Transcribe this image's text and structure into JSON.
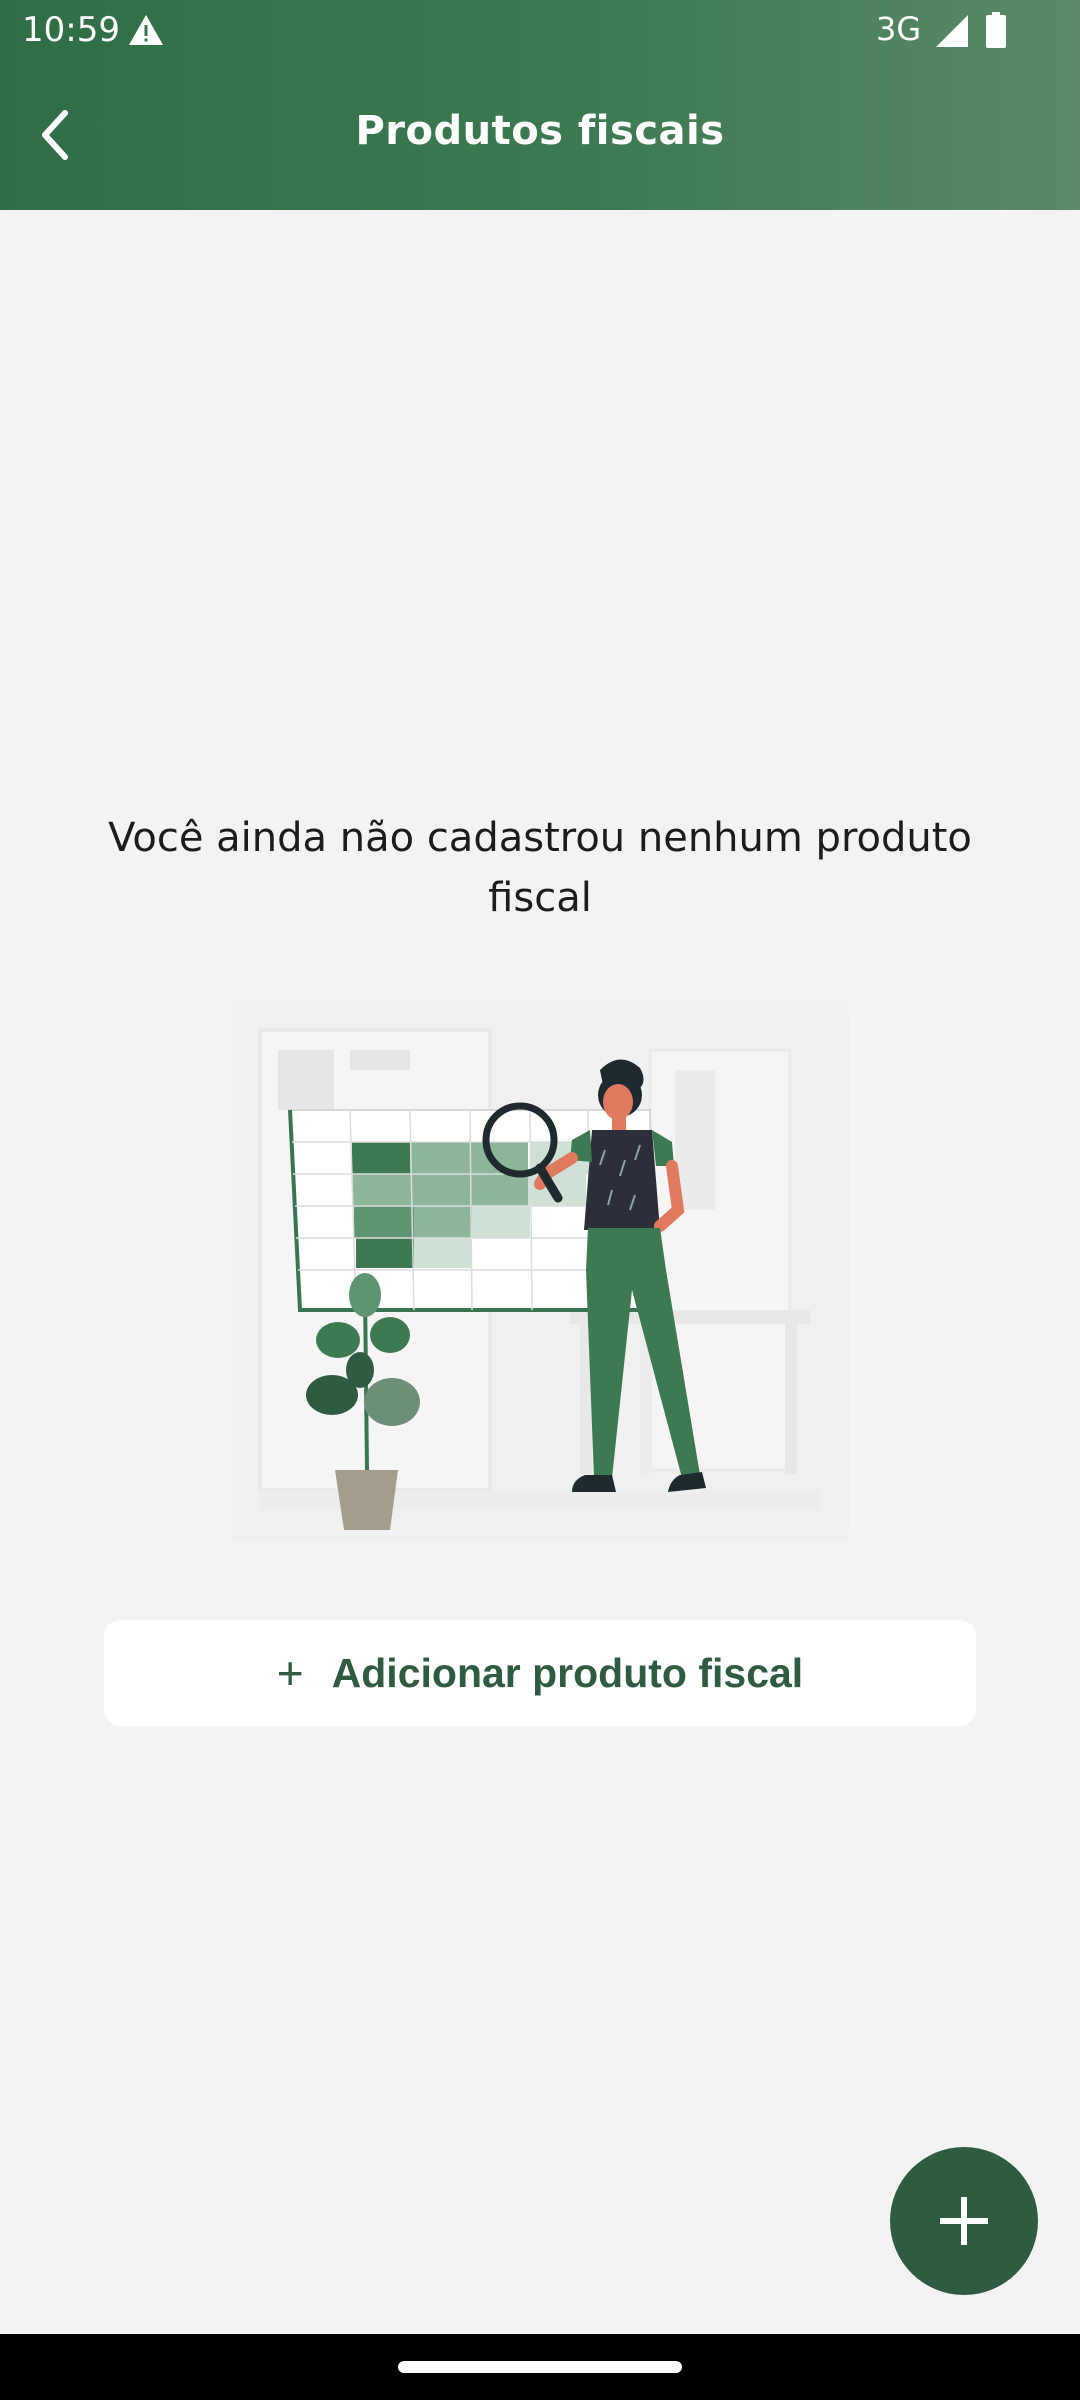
{
  "status_bar": {
    "time": "10:59",
    "network": "3G"
  },
  "header": {
    "title": "Produtos fiscais"
  },
  "empty_state": {
    "message": "Você ainda não cadastrou nenhum produto fiscal",
    "add_button_icon": "+",
    "add_button_label": "Adicionar produto fiscal"
  },
  "fab": {
    "icon": "plus-icon"
  },
  "colors": {
    "header": "#3d7a51",
    "accent": "#2f5b40",
    "background": "#f3f3f3"
  }
}
